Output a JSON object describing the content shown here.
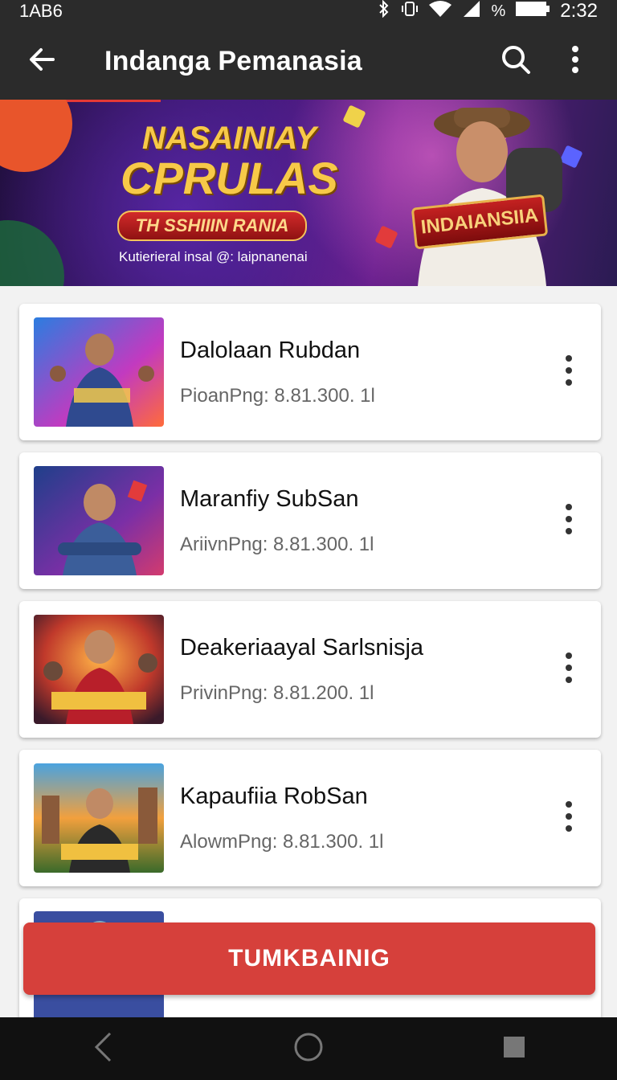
{
  "status_bar": {
    "left_text": "1AB6",
    "battery_text": "%",
    "time": "2:32"
  },
  "app_bar": {
    "title": "Indanga Pemanasia",
    "icons": [
      "back-arrow-icon",
      "search-icon",
      "more-vertical-icon"
    ]
  },
  "banner": {
    "headline_line1": "NASAINIAY",
    "headline_line2": "CPRULAS",
    "ribbon_text": "TH SSHIIIN RANIA",
    "caption": "Kutierieral insal @: laipnanenai",
    "badge_text": "INDAIANSIIA"
  },
  "items": [
    {
      "name": "Dalolaan Rubdan",
      "sub": "PioanPng:  8.81.300. 1l"
    },
    {
      "name": "Maranfiy SubSan",
      "sub": "AriivnPng:  8.81.300. 1l"
    },
    {
      "name": "Deakeriaayal Sarlsnisja",
      "sub": "PrivinPng:  8.81.200. 1l"
    },
    {
      "name": "Kapaufiia RobSan",
      "sub": "AlowmPng:  8.81.300. 1l"
    }
  ],
  "action_button": {
    "label": "TUMKBAINIG"
  },
  "colors": {
    "app_bar": "#2b2b2b",
    "accent": "#d6403b",
    "background": "#f2f2f2"
  }
}
